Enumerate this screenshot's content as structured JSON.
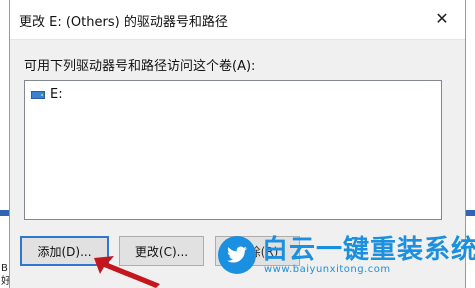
{
  "dialog": {
    "title": "更改 E: (Others) 的驱动器号和路径",
    "instruction": "可用下列驱动器号和路径访问这个卷(A):",
    "list_items": [
      {
        "label": "E:"
      }
    ],
    "buttons": {
      "add": "添加(D)...",
      "change": "更改(C)...",
      "remove": "删除(R)"
    }
  },
  "background_window": {
    "text_line_1": "B",
    "text_line_2": "好"
  },
  "watermark": {
    "title": "白云一键重装系统",
    "url": "www.baiyunxitong.com",
    "color": "#1b8fe0"
  },
  "colors": {
    "focus_border": "#2f78d0",
    "arrow": "#c4161c"
  }
}
